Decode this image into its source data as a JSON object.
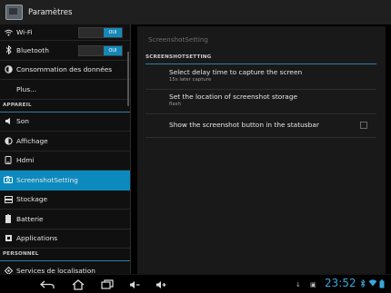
{
  "header": {
    "title": "Paramètres"
  },
  "left": {
    "sections": {
      "appareil": "APPAREIL",
      "personnel": "PERSONNEL"
    },
    "items": [
      {
        "label": "Wi-Fi",
        "icon": "wifi-icon",
        "toggle": "OUI"
      },
      {
        "label": "Bluetooth",
        "icon": "bluetooth-icon",
        "toggle": "OUI"
      },
      {
        "label": "Consommation des données",
        "icon": "data-usage-icon"
      },
      {
        "label": "Plus...",
        "icon": ""
      },
      {
        "label": "Son",
        "icon": "sound-icon"
      },
      {
        "label": "Affichage",
        "icon": "display-icon"
      },
      {
        "label": "Hdmi",
        "icon": "hdmi-icon"
      },
      {
        "label": "ScreenshotSetting",
        "icon": "screenshot-icon",
        "active": true
      },
      {
        "label": "Stockage",
        "icon": "storage-icon"
      },
      {
        "label": "Batterie",
        "icon": "battery-icon"
      },
      {
        "label": "Applications",
        "icon": "apps-icon"
      },
      {
        "label": "Services de localisation",
        "icon": "location-icon"
      }
    ]
  },
  "right": {
    "breadcrumb": "ScreenshotSetting",
    "section_header": "SCREENSHOTSETTING",
    "prefs": [
      {
        "title": "Select delay time to capture the screen",
        "summary": "15s later capture"
      },
      {
        "title": "Set the location of screenshot storage",
        "summary": "flash"
      },
      {
        "title": "Show the screenshot button in the statusbar",
        "summary": "",
        "checked": false
      }
    ]
  },
  "navbar": {
    "time": "23:52"
  },
  "colors": {
    "accent": "#0d8abd",
    "clock": "#39a6db"
  }
}
